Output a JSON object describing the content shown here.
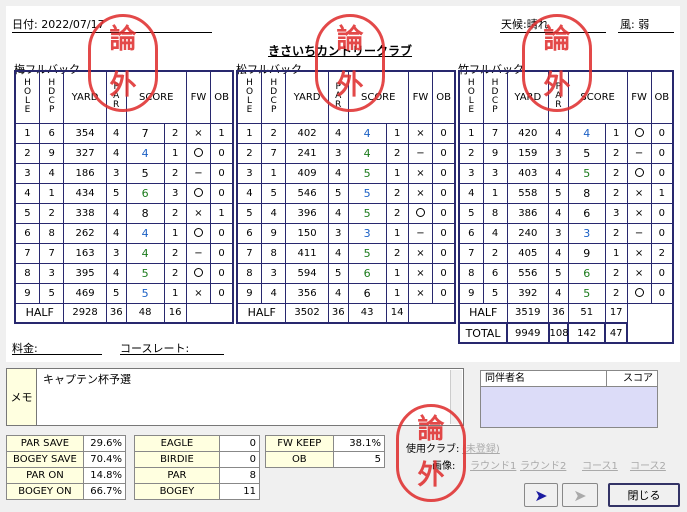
{
  "header": {
    "date_label": "日付:",
    "date": "2022/07/17",
    "weather_label": "天候:",
    "weather": "晴れ",
    "wind_label": "風:",
    "wind": "弱",
    "title": "きさいちカントリークラブ"
  },
  "courses": [
    {
      "name": "梅フルバック",
      "rows": [
        [
          "1",
          "6",
          "354",
          "4",
          "7",
          "2",
          "×",
          "1"
        ],
        [
          "2",
          "9",
          "327",
          "4",
          "4",
          "1",
          "○",
          "0"
        ],
        [
          "3",
          "4",
          "186",
          "3",
          "5",
          "2",
          "−",
          "0"
        ],
        [
          "4",
          "1",
          "434",
          "5",
          "6",
          "3",
          "○",
          "0"
        ],
        [
          "5",
          "2",
          "338",
          "4",
          "8",
          "2",
          "×",
          "1"
        ],
        [
          "6",
          "8",
          "262",
          "4",
          "4",
          "1",
          "○",
          "0"
        ],
        [
          "7",
          "7",
          "163",
          "3",
          "4",
          "2",
          "−",
          "0"
        ],
        [
          "8",
          "3",
          "395",
          "4",
          "5",
          "2",
          "○",
          "0"
        ],
        [
          "9",
          "5",
          "469",
          "5",
          "5",
          "1",
          "×",
          "0"
        ]
      ],
      "half": [
        "HALF",
        "2928",
        "36",
        "48",
        "16"
      ]
    },
    {
      "name": "松フルバック",
      "rows": [
        [
          "1",
          "2",
          "402",
          "4",
          "4",
          "1",
          "×",
          "0"
        ],
        [
          "2",
          "7",
          "241",
          "3",
          "4",
          "2",
          "−",
          "0"
        ],
        [
          "3",
          "1",
          "409",
          "4",
          "5",
          "1",
          "×",
          "0"
        ],
        [
          "4",
          "5",
          "546",
          "5",
          "5",
          "2",
          "×",
          "0"
        ],
        [
          "5",
          "4",
          "396",
          "4",
          "5",
          "2",
          "○",
          "0"
        ],
        [
          "6",
          "9",
          "150",
          "3",
          "3",
          "1",
          "−",
          "0"
        ],
        [
          "7",
          "8",
          "411",
          "4",
          "5",
          "2",
          "×",
          "0"
        ],
        [
          "8",
          "3",
          "594",
          "5",
          "6",
          "1",
          "×",
          "0"
        ],
        [
          "9",
          "4",
          "356",
          "4",
          "6",
          "1",
          "×",
          "0"
        ]
      ],
      "half": [
        "HALF",
        "3502",
        "36",
        "43",
        "14"
      ]
    },
    {
      "name": "竹フルバック",
      "rows": [
        [
          "1",
          "7",
          "420",
          "4",
          "4",
          "1",
          "○",
          "0"
        ],
        [
          "2",
          "9",
          "159",
          "3",
          "5",
          "2",
          "−",
          "0"
        ],
        [
          "3",
          "3",
          "403",
          "4",
          "5",
          "2",
          "○",
          "0"
        ],
        [
          "4",
          "1",
          "558",
          "5",
          "8",
          "2",
          "×",
          "1"
        ],
        [
          "5",
          "8",
          "386",
          "4",
          "6",
          "3",
          "×",
          "0"
        ],
        [
          "6",
          "4",
          "240",
          "3",
          "3",
          "2",
          "−",
          "0"
        ],
        [
          "7",
          "2",
          "405",
          "4",
          "9",
          "1",
          "×",
          "2"
        ],
        [
          "8",
          "6",
          "556",
          "5",
          "6",
          "2",
          "×",
          "0"
        ],
        [
          "9",
          "5",
          "392",
          "4",
          "5",
          "2",
          "○",
          "0"
        ]
      ],
      "half": [
        "HALF",
        "3519",
        "36",
        "51",
        "17"
      ],
      "total": [
        "TOTAL",
        "9949",
        "108",
        "142",
        "47"
      ]
    }
  ],
  "columns": {
    "hole": "HOLE",
    "hdcp": "HDCP",
    "yard": "YARD",
    "par": "PAR",
    "score": "SCORE",
    "fw": "FW",
    "ob": "OB"
  },
  "stamp": {
    "top": "論",
    "bottom": "外"
  },
  "fee_label": "料金:",
  "rate_label": "コースレート:",
  "memo": {
    "label": "メモ",
    "text": "キャプテン杯予選"
  },
  "companions": {
    "name_col": "同伴者名",
    "score_col": "スコア"
  },
  "stats_a": [
    [
      "PAR SAVE",
      "29.6%"
    ],
    [
      "BOGEY SAVE",
      "70.4%"
    ],
    [
      "PAR ON",
      "14.8%"
    ],
    [
      "BOGEY ON",
      "66.7%"
    ]
  ],
  "stats_b": [
    [
      "EAGLE",
      "0"
    ],
    [
      "BIRDIE",
      "0"
    ],
    [
      "PAR",
      "8"
    ],
    [
      "BOGEY",
      "11"
    ]
  ],
  "stats_c": [
    [
      "FW KEEP",
      "38.1%"
    ],
    [
      "OB",
      "5"
    ]
  ],
  "club_label": "使用クラブ:",
  "club_value": "(未登録)",
  "image_label": "画像:",
  "image_links": [
    "ラウンド1",
    "ラウンド2",
    "コース1",
    "コース2"
  ],
  "close_label": "閉じる",
  "colors": {
    "stamp": "#e03030",
    "grid": "#28286e",
    "blue_score": "#1a5fc4"
  }
}
